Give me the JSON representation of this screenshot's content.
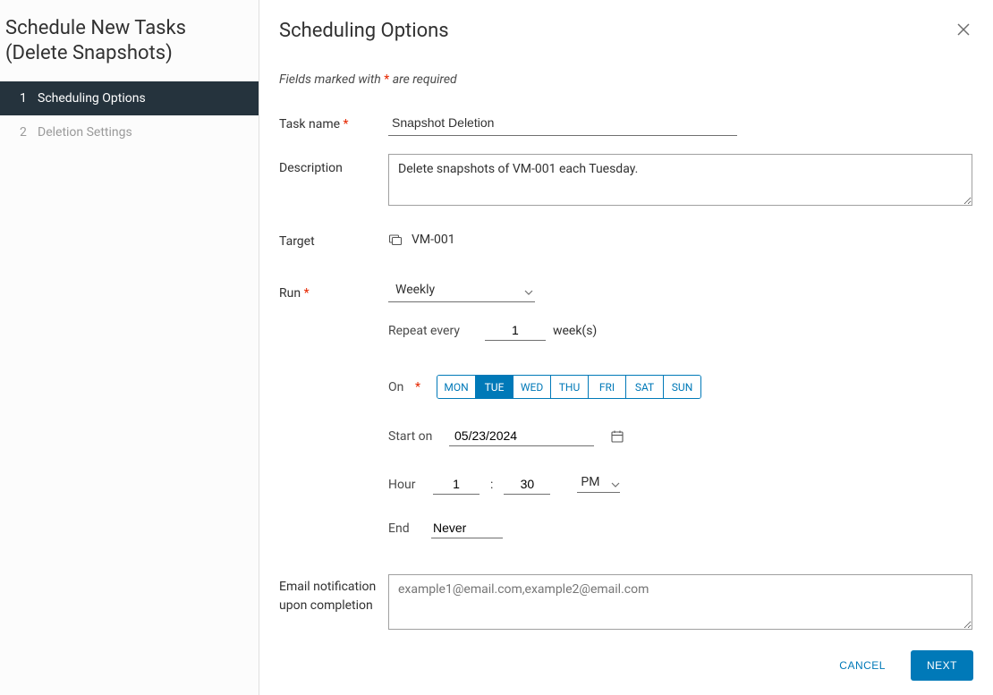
{
  "sidebar": {
    "title": "Schedule New Tasks\n(Delete Snapshots)",
    "steps": [
      {
        "num": "1",
        "label": "Scheduling Options"
      },
      {
        "num": "2",
        "label": "Deletion Settings"
      }
    ]
  },
  "header": {
    "title": "Scheduling Options"
  },
  "requiredNote": {
    "prefix": "Fields marked with ",
    "star": "*",
    "suffix": " are required"
  },
  "form": {
    "taskName": {
      "label": "Task name",
      "value": "Snapshot Deletion"
    },
    "description": {
      "label": "Description",
      "value": "Delete snapshots of VM-001 each Tuesday."
    },
    "target": {
      "label": "Target",
      "value": "VM-001"
    },
    "run": {
      "label": "Run",
      "value": "Weekly",
      "repeat": {
        "label": "Repeat every",
        "value": "1",
        "unit": "week(s)"
      },
      "on": {
        "label": "On",
        "days": [
          "MON",
          "TUE",
          "WED",
          "THU",
          "FRI",
          "SAT",
          "SUN"
        ],
        "selected": "TUE"
      },
      "start": {
        "label": "Start on",
        "value": "05/23/2024"
      },
      "hour": {
        "label": "Hour",
        "h": "1",
        "m": "30",
        "ampm": "PM"
      },
      "end": {
        "label": "End",
        "value": "Never"
      }
    },
    "email": {
      "labelLine1": "Email notification",
      "labelLine2": "upon completion",
      "placeholder": "example1@email.com,example2@email.com",
      "value": ""
    }
  },
  "footer": {
    "cancel": "CANCEL",
    "next": "NEXT"
  }
}
